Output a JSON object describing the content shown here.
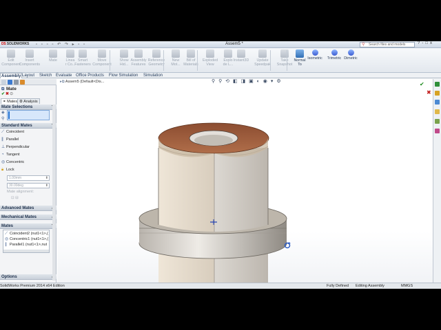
{
  "app": {
    "logo_text": "SOLIDWORKS",
    "document_title": "Assem5 *",
    "search_placeholder": "Search files and models",
    "window_controls": [
      "?",
      "-",
      "□",
      "x"
    ]
  },
  "ribbon": {
    "buttons": [
      {
        "label_1": "Edit",
        "label_2": "Component",
        "icon": "edit-component-icon",
        "enabled": false
      },
      {
        "label_1": "Insert",
        "label_2": "Components",
        "icon": "insert-components-icon",
        "enabled": false
      },
      {
        "label_1": "Mate",
        "label_2": "",
        "icon": "mate-icon",
        "enabled": false
      },
      {
        "label_1": "Linea",
        "label_2": "r Co...",
        "icon": "linear-pattern-icon",
        "enabled": false
      },
      {
        "label_1": "Smart",
        "label_2": "Fasteners",
        "icon": "smart-fasteners-icon",
        "enabled": false
      },
      {
        "label_1": "Move",
        "label_2": "Component",
        "icon": "move-component-icon",
        "enabled": false
      },
      {
        "label_1": "Show",
        "label_2": "Hid...",
        "icon": "show-hidden-icon",
        "enabled": false
      },
      {
        "label_1": "Assembly",
        "label_2": "Features",
        "icon": "assembly-features-icon",
        "enabled": false
      },
      {
        "label_1": "Reference",
        "label_2": "Geometry",
        "icon": "reference-geometry-icon",
        "enabled": false
      },
      {
        "label_1": "New",
        "label_2": "Mot...",
        "icon": "new-motion-icon",
        "enabled": false
      },
      {
        "label_1": "Bill of",
        "label_2": "Materials",
        "icon": "bill-of-materials-icon",
        "enabled": false
      },
      {
        "label_1": "Exploded",
        "label_2": "View",
        "icon": "exploded-view-icon",
        "enabled": false
      },
      {
        "label_1": "Explo",
        "label_2": "de L...",
        "icon": "explode-line-icon",
        "enabled": false
      },
      {
        "label_1": "Instant3D",
        "label_2": "",
        "icon": "instant3d-icon",
        "enabled": false
      },
      {
        "label_1": "Update",
        "label_2": "Speedpak",
        "icon": "update-speedpak-icon",
        "enabled": false
      },
      {
        "label_1": "Take",
        "label_2": "Snapshot",
        "icon": "take-snapshot-icon",
        "enabled": false
      },
      {
        "label_1": "Normal",
        "label_2": "To",
        "icon": "normal-to-icon",
        "enabled": true
      },
      {
        "label_1": "Isometric",
        "label_2": "",
        "icon": "isometric-icon",
        "enabled": true
      },
      {
        "label_1": "Trimetric",
        "label_2": "",
        "icon": "trimetric-icon",
        "enabled": true
      },
      {
        "label_1": "Dimetric",
        "label_2": "",
        "icon": "dimetric-icon",
        "enabled": true
      }
    ]
  },
  "command_tabs": [
    "Assembly",
    "Layout",
    "Sketch",
    "Evaluate",
    "Office Products",
    "Flow Simulation",
    "Simulation"
  ],
  "property_manager": {
    "title": "Mate",
    "subtabs": [
      "Mates",
      "Analysis"
    ],
    "sections": {
      "mate_selections": "Mate Selections",
      "standard_mates": "Standard Mates",
      "advanced_mates": "Advanced Mates",
      "mechanical_mates": "Mechanical Mates",
      "mates": "Mates",
      "options": "Options"
    },
    "standard_mates": [
      "Coincident",
      "Parallel",
      "Perpendicular",
      "Tangent",
      "Concentric",
      "Lock"
    ],
    "distance_value": "1.00mm",
    "angle_value": "30.00deg",
    "mate_alignment_label": "Mate alignment:",
    "mates_list": [
      "Coincident2 (nut1<1>,(",
      "Concentric1 (nut1<1>,(",
      "Parallel1 (nut1<1>,nut"
    ]
  },
  "viewport": {
    "tree_flyout": "Assem5  (Default<Dis..."
  },
  "status_bar": {
    "product": "SolidWorks Premium 2014 x64 Edition",
    "state": "Fully Defined",
    "mode": "Editing Assembly",
    "units": "MMGS"
  },
  "colors": {
    "accent": "#2f6db3",
    "copper": "#9a5a3a",
    "steel": "#d9d6d0"
  }
}
